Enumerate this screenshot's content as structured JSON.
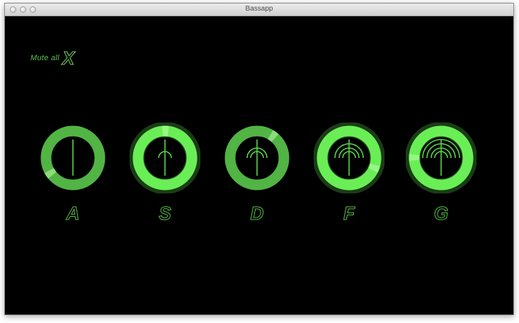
{
  "window": {
    "title": "Bassapp"
  },
  "mute": {
    "label": "Mute all",
    "key": "X"
  },
  "pads": [
    {
      "key": "A",
      "waves": 0,
      "active": false
    },
    {
      "key": "S",
      "waves": 1,
      "active": true
    },
    {
      "key": "D",
      "waves": 2,
      "active": false
    },
    {
      "key": "F",
      "waves": 3,
      "active": true
    },
    {
      "key": "G",
      "waves": 4,
      "active": true
    }
  ],
  "colors": {
    "ring_dim": "#52b444",
    "ring_bright": "#6aee56",
    "line": "#58d548",
    "text": "#5ec152"
  }
}
